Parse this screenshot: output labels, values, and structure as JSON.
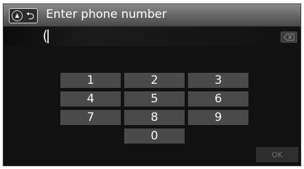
{
  "header": {
    "title": "Enter phone number",
    "back_icon": "map-knob-back-icon"
  },
  "input": {
    "value": "("
  },
  "delete_icon": "backspace-icon",
  "keypad": {
    "keys": [
      "1",
      "2",
      "3",
      "4",
      "5",
      "6",
      "7",
      "8",
      "9",
      "0"
    ]
  },
  "ok_label": "OK"
}
